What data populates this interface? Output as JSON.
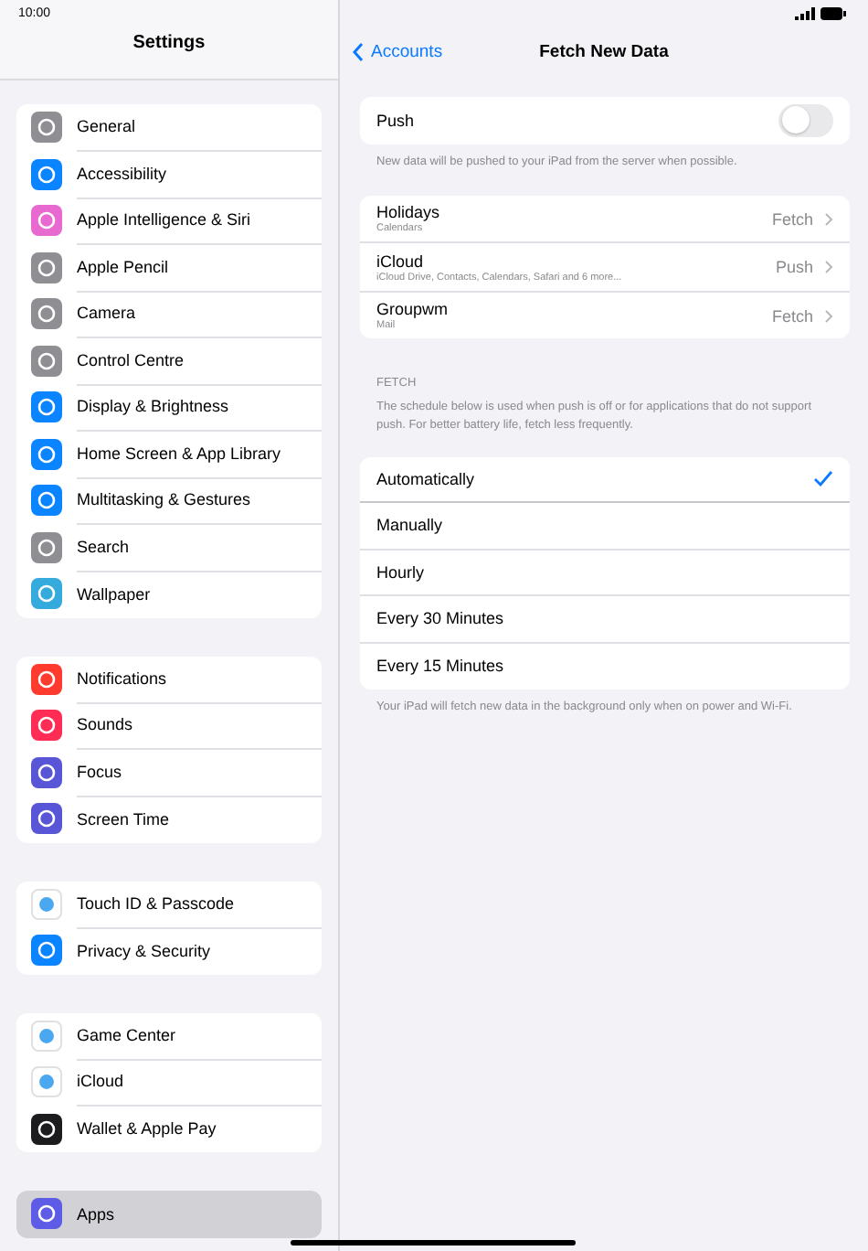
{
  "status_bar": {
    "time": "10:00"
  },
  "sidebar": {
    "title": "Settings",
    "groups": [
      {
        "items": [
          {
            "label": "General",
            "color": "#8e8e93",
            "selected": false
          },
          {
            "label": "Accessibility",
            "color": "#0a84ff",
            "selected": false
          },
          {
            "label": "Apple Intelligence & Siri",
            "color": "#e86ad0",
            "selected": false
          },
          {
            "label": "Apple Pencil",
            "color": "#8e8e93",
            "selected": false
          },
          {
            "label": "Camera",
            "color": "#8e8e93",
            "selected": false
          },
          {
            "label": "Control Centre",
            "color": "#8e8e93",
            "selected": false
          },
          {
            "label": "Display & Brightness",
            "color": "#0a84ff",
            "selected": false
          },
          {
            "label": "Home Screen & App Library",
            "color": "#0a84ff",
            "selected": false
          },
          {
            "label": "Multitasking & Gestures",
            "color": "#0a84ff",
            "selected": false
          },
          {
            "label": "Search",
            "color": "#8e8e93",
            "selected": false
          },
          {
            "label": "Wallpaper",
            "color": "#35aadc",
            "selected": false
          }
        ]
      },
      {
        "items": [
          {
            "label": "Notifications",
            "color": "#ff3b30",
            "selected": false
          },
          {
            "label": "Sounds",
            "color": "#ff2d55",
            "selected": false
          },
          {
            "label": "Focus",
            "color": "#5856d6",
            "selected": false
          },
          {
            "label": "Screen Time",
            "color": "#5856d6",
            "selected": false
          }
        ]
      },
      {
        "items": [
          {
            "label": "Touch ID & Passcode",
            "color": "#ffffff",
            "selected": false
          },
          {
            "label": "Privacy & Security",
            "color": "#0a84ff",
            "selected": false
          }
        ]
      },
      {
        "items": [
          {
            "label": "Game Center",
            "color": "#ffffff",
            "selected": false
          },
          {
            "label": "iCloud",
            "color": "#ffffff",
            "selected": false
          },
          {
            "label": "Wallet & Apple Pay",
            "color": "#1c1c1e",
            "selected": false
          }
        ]
      },
      {
        "items": [
          {
            "label": "Apps",
            "color": "#5e5ce6",
            "selected": true
          }
        ]
      }
    ]
  },
  "detail": {
    "back": "Accounts",
    "title": "Fetch New Data",
    "push": {
      "label": "Push",
      "on": false,
      "note": "New data will be pushed to your iPad from the server when possible."
    },
    "accounts": [
      {
        "name": "Holidays",
        "detail": "Calendars",
        "value": "Fetch"
      },
      {
        "name": "iCloud",
        "detail": "iCloud Drive, Contacts, Calendars, Safari and 6 more...",
        "value": "Push"
      },
      {
        "name": "Groupwm",
        "detail": "Mail",
        "value": "Fetch"
      }
    ],
    "fetch_header": "FETCH",
    "fetch_note": "The schedule below is used when push is off or for applications that do not support push. For better battery life, fetch less frequently.",
    "options": [
      {
        "label": "Automatically",
        "selected": true
      },
      {
        "label": "Manually",
        "selected": false
      },
      {
        "label": "Hourly",
        "selected": false
      },
      {
        "label": "Every 30 Minutes",
        "selected": false
      },
      {
        "label": "Every 15 Minutes",
        "selected": false
      }
    ],
    "footer": "Your iPad will fetch new data in the background only when on power and Wi-Fi."
  }
}
